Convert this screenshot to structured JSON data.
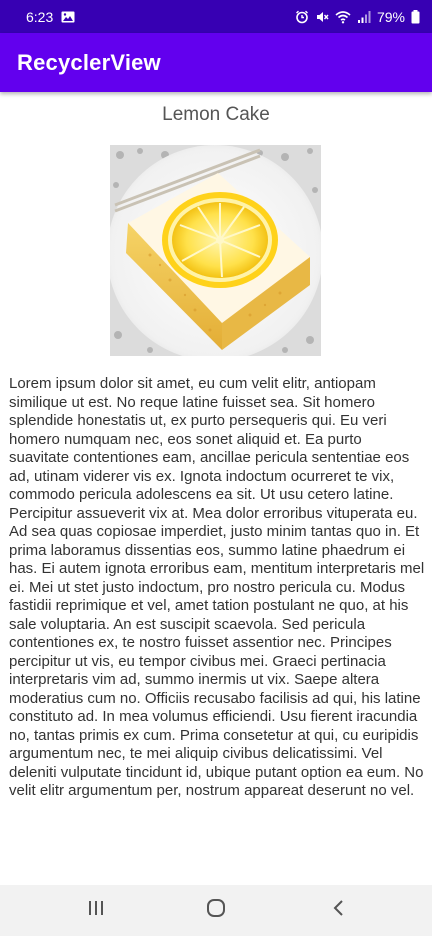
{
  "status_bar": {
    "time": "6:23",
    "battery": "79%",
    "icons": [
      "image-icon",
      "alarm-icon",
      "mute-icon",
      "wifi-icon",
      "signal-icon",
      "battery-icon"
    ]
  },
  "app_bar": {
    "title": "RecyclerView"
  },
  "item": {
    "title": "Lemon Cake",
    "image": "lemon-cake-photo",
    "description": "Lorem ipsum dolor sit amet, eu cum velit elitr, antiopam similique ut est. No reque latine fuisset sea. Sit homero splendide honestatis ut, ex purto persequeris qui. Eu veri homero numquam nec, eos sonet aliquid et. Ea purto suavitate contentiones eam, ancillae pericula sententiae eos ad, utinam viderer vis ex. Ignota indoctum ocurreret te vix, commodo pericula adolescens ea sit. Ut usu cetero latine. Percipitur assueverit vix at. Mea dolor erroribus vituperata eu. Ad sea quas copiosae imperdiet, justo minim tantas quo in. Et prima laboramus dissentias eos, summo latine phaedrum ei has. Ei autem ignota erroribus eam, mentitum interpretaris mel ei. Mei ut stet justo indoctum, pro nostro pericula cu. Modus fastidii reprimique et vel, amet tation postulant ne quo, at his sale voluptaria. An est suscipit scaevola. Sed pericula contentiones ex, te nostro fuisset assentior nec. Principes percipitur ut vis, eu tempor civibus mei. Graeci pertinacia interpretaris vim ad, summo inermis ut vix. Saepe altera moderatius cum no. Officiis recusabo facilisis ad qui, his latine constituto ad. In mea volumus efficiendi. Usu fierent iracundia no, tantas primis ex cum. Prima consetetur at qui, cu euripidis argumentum nec, te mei aliquip civibus delicatissimi. Vel deleniti vulputate tincidunt id, ubique putant option ea eum. No velit elitr argumentum per, nostrum appareat deserunt no vel."
  },
  "nav_bar": {
    "buttons": [
      "recents-icon",
      "home-icon",
      "back-icon"
    ]
  }
}
